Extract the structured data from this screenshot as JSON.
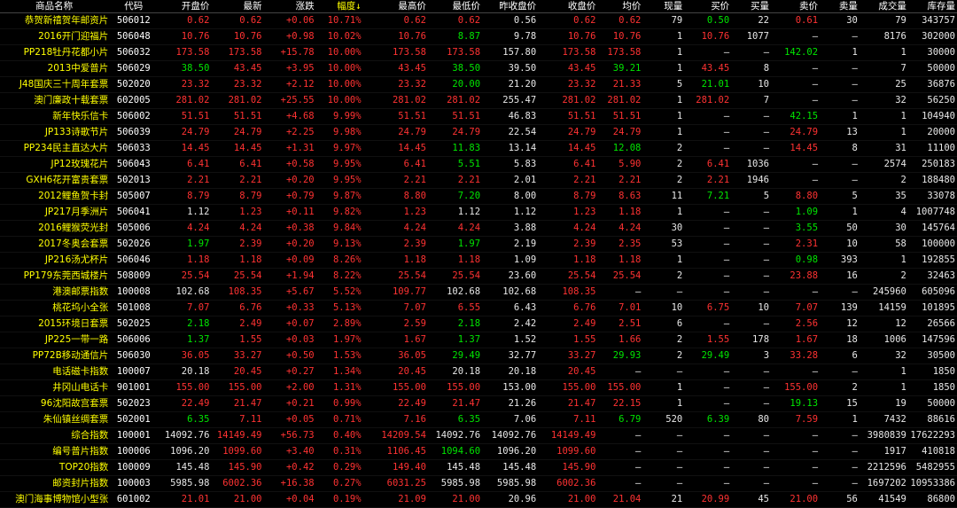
{
  "columns": [
    {
      "label": "商品名称"
    },
    {
      "label": "代码"
    },
    {
      "label": "开盘价"
    },
    {
      "label": "最新"
    },
    {
      "label": "涨跌"
    },
    {
      "label": "幅度↓",
      "sorted": true
    },
    {
      "label": "最高价"
    },
    {
      "label": "最低价"
    },
    {
      "label": "昨收盘价"
    },
    {
      "label": "收盘价"
    },
    {
      "label": "均价"
    },
    {
      "label": "现量"
    },
    {
      "label": "买价"
    },
    {
      "label": "买量"
    },
    {
      "label": "卖价"
    },
    {
      "label": "卖量"
    },
    {
      "label": "成交量"
    },
    {
      "label": "库存量"
    }
  ],
  "colors": {
    "up": "#ff3232",
    "down": "#00e600",
    "neutral": "#e8e8e8",
    "name": "#ffff00"
  },
  "rows": [
    [
      "恭贺新禧贺年邮资片",
      "506012",
      "0.62",
      "0.62",
      "+0.06",
      "10.71%",
      "0.62",
      "0.62",
      "0.56",
      "0.62",
      "0.62",
      "79",
      "0.50",
      "22",
      "0.61",
      "30",
      "79",
      "343757"
    ],
    [
      "2016开门迎福片",
      "506048",
      "10.76",
      "10.76",
      "+0.98",
      "10.02%",
      "10.76",
      "8.87",
      "9.78",
      "10.76",
      "10.76",
      "1",
      "10.76",
      "1077",
      "—",
      "—",
      "8176",
      "302000"
    ],
    [
      "PP218牡丹花都小片",
      "506032",
      "173.58",
      "173.58",
      "+15.78",
      "10.00%",
      "173.58",
      "173.58",
      "157.80",
      "173.58",
      "173.58",
      "1",
      "—",
      "—",
      "142.02",
      "1",
      "1",
      "30000"
    ],
    [
      "2013中爱普片",
      "506029",
      "38.50",
      "43.45",
      "+3.95",
      "10.00%",
      "43.45",
      "38.50",
      "39.50",
      "43.45",
      "39.21",
      "1",
      "43.45",
      "8",
      "—",
      "—",
      "7",
      "50000"
    ],
    [
      "J48国庆三十周年套票",
      "502020",
      "23.32",
      "23.32",
      "+2.12",
      "10.00%",
      "23.32",
      "20.00",
      "21.20",
      "23.32",
      "21.33",
      "5",
      "21.01",
      "10",
      "—",
      "—",
      "25",
      "36876"
    ],
    [
      "澳门廉政十载套票",
      "602005",
      "281.02",
      "281.02",
      "+25.55",
      "10.00%",
      "281.02",
      "281.02",
      "255.47",
      "281.02",
      "281.02",
      "1",
      "281.02",
      "7",
      "—",
      "—",
      "32",
      "56250"
    ],
    [
      "新年快乐信卡",
      "506002",
      "51.51",
      "51.51",
      "+4.68",
      "9.99%",
      "51.51",
      "51.51",
      "46.83",
      "51.51",
      "51.51",
      "1",
      "—",
      "—",
      "42.15",
      "1",
      "1",
      "104940"
    ],
    [
      "JP133诗歌节片",
      "506039",
      "24.79",
      "24.79",
      "+2.25",
      "9.98%",
      "24.79",
      "24.79",
      "22.54",
      "24.79",
      "24.79",
      "1",
      "—",
      "—",
      "24.79",
      "13",
      "1",
      "20000"
    ],
    [
      "PP234民主直达大片",
      "506033",
      "14.45",
      "14.45",
      "+1.31",
      "9.97%",
      "14.45",
      "11.83",
      "13.14",
      "14.45",
      "12.08",
      "2",
      "—",
      "—",
      "14.45",
      "8",
      "31",
      "11100"
    ],
    [
      "JP12玫瑰花片",
      "506043",
      "6.41",
      "6.41",
      "+0.58",
      "9.95%",
      "6.41",
      "5.51",
      "5.83",
      "6.41",
      "5.90",
      "2",
      "6.41",
      "1036",
      "—",
      "—",
      "2574",
      "250183"
    ],
    [
      "GXH6花开富贵套票",
      "502013",
      "2.21",
      "2.21",
      "+0.20",
      "9.95%",
      "2.21",
      "2.21",
      "2.01",
      "2.21",
      "2.21",
      "2",
      "2.21",
      "1946",
      "—",
      "—",
      "2",
      "188480"
    ],
    [
      "2012鲤鱼贺卡封",
      "505007",
      "8.79",
      "8.79",
      "+0.79",
      "9.87%",
      "8.80",
      "7.20",
      "8.00",
      "8.79",
      "8.63",
      "11",
      "7.21",
      "5",
      "8.80",
      "5",
      "35",
      "33078"
    ],
    [
      "JP217月季洲片",
      "506041",
      "1.12",
      "1.23",
      "+0.11",
      "9.82%",
      "1.23",
      "1.12",
      "1.12",
      "1.23",
      "1.18",
      "1",
      "—",
      "—",
      "1.09",
      "1",
      "4",
      "1007748"
    ],
    [
      "2016鲤猴荧光封",
      "505006",
      "4.24",
      "4.24",
      "+0.38",
      "9.84%",
      "4.24",
      "4.24",
      "3.88",
      "4.24",
      "4.24",
      "30",
      "—",
      "—",
      "3.55",
      "50",
      "30",
      "145764"
    ],
    [
      "2017冬奥会套票",
      "502026",
      "1.97",
      "2.39",
      "+0.20",
      "9.13%",
      "2.39",
      "1.97",
      "2.19",
      "2.39",
      "2.35",
      "53",
      "—",
      "—",
      "2.31",
      "10",
      "58",
      "100000"
    ],
    [
      "JP216汤尤杯片",
      "506046",
      "1.18",
      "1.18",
      "+0.09",
      "8.26%",
      "1.18",
      "1.18",
      "1.09",
      "1.18",
      "1.18",
      "1",
      "—",
      "—",
      "0.98",
      "393",
      "1",
      "192855"
    ],
    [
      "PP179东莞西城楼片",
      "508009",
      "25.54",
      "25.54",
      "+1.94",
      "8.22%",
      "25.54",
      "25.54",
      "23.60",
      "25.54",
      "25.54",
      "2",
      "—",
      "—",
      "23.88",
      "16",
      "2",
      "32463"
    ],
    [
      "港澳邮票指数",
      "100008",
      "102.68",
      "108.35",
      "+5.67",
      "5.52%",
      "109.77",
      "102.68",
      "102.68",
      "108.35",
      "—",
      "—",
      "—",
      "—",
      "—",
      "—",
      "245960",
      "605096"
    ],
    [
      "桃花坞小全张",
      "501008",
      "7.07",
      "6.76",
      "+0.33",
      "5.13%",
      "7.07",
      "6.55",
      "6.43",
      "6.76",
      "7.01",
      "10",
      "6.75",
      "10",
      "7.07",
      "139",
      "14159",
      "101895"
    ],
    [
      "2015环境日套票",
      "502025",
      "2.18",
      "2.49",
      "+0.07",
      "2.89%",
      "2.59",
      "2.18",
      "2.42",
      "2.49",
      "2.51",
      "6",
      "—",
      "—",
      "2.56",
      "12",
      "12",
      "26566"
    ],
    [
      "JP225一带一路",
      "506006",
      "1.37",
      "1.55",
      "+0.03",
      "1.97%",
      "1.67",
      "1.37",
      "1.52",
      "1.55",
      "1.66",
      "2",
      "1.55",
      "178",
      "1.67",
      "18",
      "1006",
      "147596"
    ],
    [
      "PP72B移动通信片",
      "506030",
      "36.05",
      "33.27",
      "+0.50",
      "1.53%",
      "36.05",
      "29.49",
      "32.77",
      "33.27",
      "29.93",
      "2",
      "29.49",
      "3",
      "33.28",
      "6",
      "32",
      "30500"
    ],
    [
      "电话磁卡指数",
      "100007",
      "20.18",
      "20.45",
      "+0.27",
      "1.34%",
      "20.45",
      "20.18",
      "20.18",
      "20.45",
      "—",
      "—",
      "—",
      "—",
      "—",
      "—",
      "1",
      "1850"
    ],
    [
      "井冈山电话卡",
      "901001",
      "155.00",
      "155.00",
      "+2.00",
      "1.31%",
      "155.00",
      "155.00",
      "153.00",
      "155.00",
      "155.00",
      "1",
      "—",
      "—",
      "155.00",
      "2",
      "1",
      "1850"
    ],
    [
      "96沈阳故宫套票",
      "502023",
      "22.49",
      "21.47",
      "+0.21",
      "0.99%",
      "22.49",
      "21.47",
      "21.26",
      "21.47",
      "22.15",
      "1",
      "—",
      "—",
      "19.13",
      "15",
      "19",
      "50000"
    ],
    [
      "朱仙镇丝绸套票",
      "502001",
      "6.35",
      "7.11",
      "+0.05",
      "0.71%",
      "7.16",
      "6.35",
      "7.06",
      "7.11",
      "6.79",
      "520",
      "6.39",
      "80",
      "7.59",
      "1",
      "7432",
      "88616"
    ],
    [
      "综合指数",
      "100001",
      "14092.76",
      "14149.49",
      "+56.73",
      "0.40%",
      "14209.54",
      "14092.76",
      "14092.76",
      "14149.49",
      "—",
      "—",
      "—",
      "—",
      "—",
      "—",
      "3980839",
      "17622293"
    ],
    [
      "编号普片指数",
      "100006",
      "1096.20",
      "1099.60",
      "+3.40",
      "0.31%",
      "1106.45",
      "1094.60",
      "1096.20",
      "1099.60",
      "—",
      "—",
      "—",
      "—",
      "—",
      "—",
      "1917",
      "410818"
    ],
    [
      "TOP20指数",
      "100009",
      "145.48",
      "145.90",
      "+0.42",
      "0.29%",
      "149.40",
      "145.48",
      "145.48",
      "145.90",
      "—",
      "—",
      "—",
      "—",
      "—",
      "—",
      "2212596",
      "5482955"
    ],
    [
      "邮资封片指数",
      "100003",
      "5985.98",
      "6002.36",
      "+16.38",
      "0.27%",
      "6031.25",
      "5985.98",
      "5985.98",
      "6002.36",
      "—",
      "—",
      "—",
      "—",
      "—",
      "—",
      "1697202",
      "10953386"
    ],
    [
      "澳门海事博物馆小型张",
      "601002",
      "21.01",
      "21.00",
      "+0.04",
      "0.19%",
      "21.09",
      "21.00",
      "20.96",
      "21.00",
      "21.04",
      "21",
      "20.99",
      "45",
      "21.00",
      "56",
      "41549",
      "86800"
    ]
  ]
}
